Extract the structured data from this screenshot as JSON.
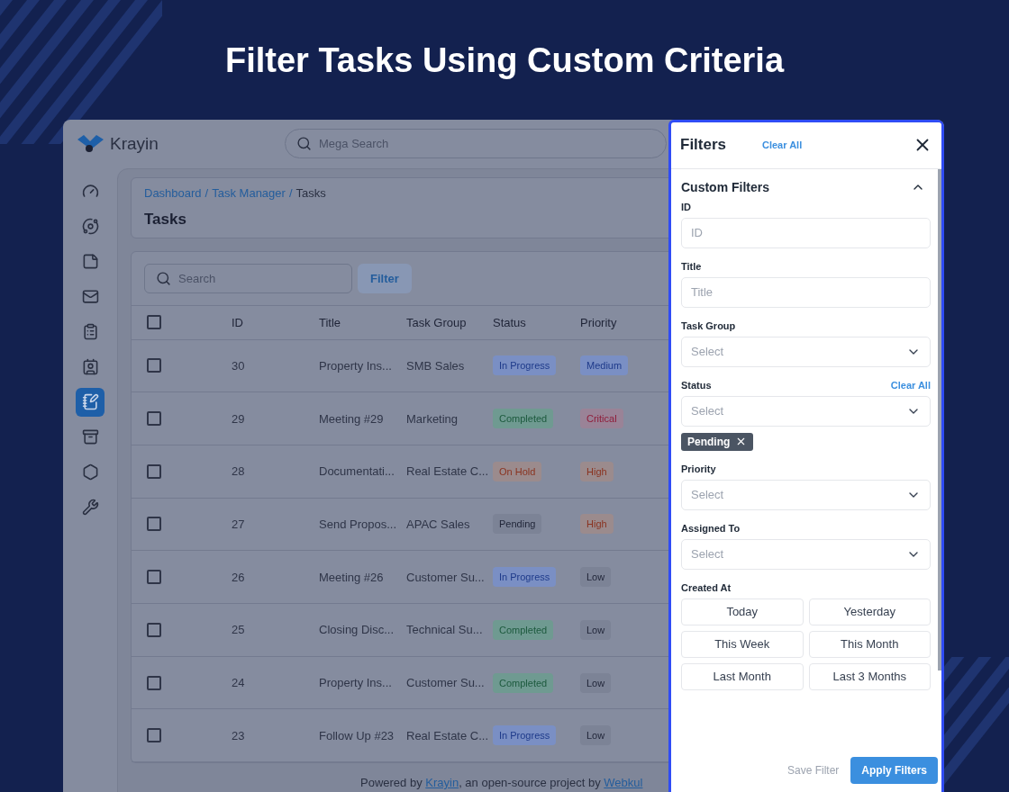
{
  "page_title": "Filter Tasks Using Custom Criteria",
  "app": {
    "brand": "Krayin",
    "search": {
      "placeholder": "Mega Search"
    },
    "sidebar": {
      "items": [
        {
          "selected": false
        },
        {
          "selected": false
        },
        {
          "selected": false
        },
        {
          "selected": false
        },
        {
          "selected": false
        },
        {
          "selected": false
        },
        {
          "selected": true
        },
        {
          "selected": false
        },
        {
          "selected": false
        },
        {
          "selected": false
        }
      ]
    },
    "breadcrumb_separator": "/",
    "breadcrumb": [
      {
        "label": "Dashboard",
        "link": true
      },
      {
        "label": "Task Manager",
        "link": true
      },
      {
        "label": "Tasks",
        "link": false
      }
    ],
    "heading": "Tasks",
    "toolbar": {
      "search_placeholder": "Search",
      "filter_button": "Filter"
    },
    "table": {
      "select_all": {
        "checked": false
      },
      "columns": [
        "ID",
        "Title",
        "Task Group",
        "Status",
        "Priority"
      ],
      "rows": [
        {
          "checked": false,
          "id": "30",
          "title": "Property Ins...",
          "task_group": "SMB Sales",
          "status": {
            "label": "In Progress",
            "kind": "info"
          },
          "priority": {
            "label": "Medium",
            "kind": "info"
          }
        },
        {
          "checked": false,
          "id": "29",
          "title": "Meeting #29",
          "task_group": "Marketing",
          "status": {
            "label": "Completed",
            "kind": "success"
          },
          "priority": {
            "label": "Critical",
            "kind": "danger"
          }
        },
        {
          "checked": false,
          "id": "28",
          "title": "Documentati...",
          "task_group": "Real Estate C...",
          "status": {
            "label": "On Hold",
            "kind": "warning"
          },
          "priority": {
            "label": "High",
            "kind": "warning"
          }
        },
        {
          "checked": false,
          "id": "27",
          "title": "Send Propos...",
          "task_group": "APAC Sales",
          "status": {
            "label": "Pending",
            "kind": "neutral"
          },
          "priority": {
            "label": "High",
            "kind": "warning"
          }
        },
        {
          "checked": false,
          "id": "26",
          "title": "Meeting #26",
          "task_group": "Customer Su...",
          "status": {
            "label": "In Progress",
            "kind": "info"
          },
          "priority": {
            "label": "Low",
            "kind": "neutral"
          }
        },
        {
          "checked": false,
          "id": "25",
          "title": "Closing Disc...",
          "task_group": "Technical Su...",
          "status": {
            "label": "Completed",
            "kind": "success"
          },
          "priority": {
            "label": "Low",
            "kind": "neutral"
          }
        },
        {
          "checked": false,
          "id": "24",
          "title": "Property Ins...",
          "task_group": "Customer Su...",
          "status": {
            "label": "Completed",
            "kind": "success"
          },
          "priority": {
            "label": "Low",
            "kind": "neutral"
          }
        },
        {
          "checked": false,
          "id": "23",
          "title": "Follow Up #23",
          "task_group": "Real Estate C...",
          "status": {
            "label": "In Progress",
            "kind": "info"
          },
          "priority": {
            "label": "Low",
            "kind": "neutral"
          }
        }
      ]
    },
    "footer": [
      {
        "text": "Powered by ",
        "link": false
      },
      {
        "text": "Krayin",
        "link": true
      },
      {
        "text": ", an open-source project by ",
        "link": false
      },
      {
        "text": "Webkul",
        "link": true
      }
    ]
  },
  "filters": {
    "title": "Filters",
    "clear_all": "Clear All",
    "section": {
      "title": "Custom Filters",
      "expanded": true
    },
    "fields": [
      {
        "kind": "text",
        "label": "ID",
        "placeholder": "ID"
      },
      {
        "kind": "text",
        "label": "Title",
        "placeholder": "Title"
      },
      {
        "kind": "select",
        "label": "Task Group",
        "placeholder": "Select"
      },
      {
        "kind": "select",
        "label": "Status",
        "placeholder": "Select",
        "clear_action": "Clear All",
        "chips": [
          "Pending"
        ]
      },
      {
        "kind": "select",
        "label": "Priority",
        "placeholder": "Select"
      },
      {
        "kind": "select",
        "label": "Assigned To",
        "placeholder": "Select"
      },
      {
        "kind": "dates",
        "label": "Created At",
        "options": [
          "Today",
          "Yesterday",
          "This Week",
          "This Month",
          "Last Month",
          "Last 3 Months"
        ]
      }
    ],
    "save_button": {
      "label": "Save Filter",
      "disabled": true
    },
    "apply_button": {
      "label": "Apply Filters"
    }
  }
}
